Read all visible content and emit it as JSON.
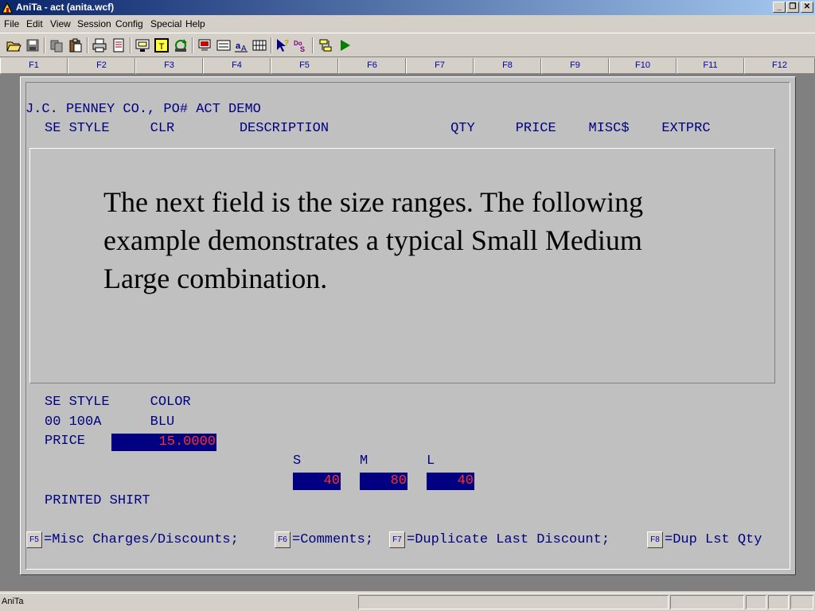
{
  "window": {
    "title": "AniTa -  act (anita.wcf)"
  },
  "menu": [
    "File",
    "Edit",
    "View",
    "Session",
    "Config",
    "Special",
    "Help"
  ],
  "fkeys": [
    "F1",
    "F2",
    "F3",
    "F4",
    "F5",
    "F6",
    "F7",
    "F8",
    "F9",
    "F10",
    "F11",
    "F12"
  ],
  "screen": {
    "header_line1": "J.C. PENNEY CO., PO# ACT DEMO",
    "header_line2": "SE STYLE     CLR        DESCRIPTION               QTY     PRICE    MISC$    EXTPRC",
    "slide_text": "The next field is the size ranges. The following example demonstrates a typical Small Medium Large combination.",
    "labels_row": "SE STYLE     COLOR",
    "values_row": "00 100A      BLU",
    "price_label": "PRICE",
    "price_value": "15.0000",
    "sizes": [
      {
        "label": "S",
        "qty": "40"
      },
      {
        "label": "M",
        "qty": "80"
      },
      {
        "label": "L",
        "qty": "40"
      }
    ],
    "description": "PRINTED SHIRT",
    "footer": {
      "f5_key": "F5",
      "f5_text": "=Misc Charges/Discounts;",
      "f6_key": "F6",
      "f6_text": "=Comments;",
      "f7_key": "F7",
      "f7_text": "=Duplicate Last Discount;",
      "f8_key": "F8",
      "f8_text": "=Dup Lst Qty"
    }
  },
  "status": {
    "text": "AniTa"
  },
  "colors": {
    "titlebar_start": "#0a246a",
    "terminal_text": "#000080",
    "field_bg": "#000080",
    "field_text": "#ff3030"
  },
  "toolbar_icons": [
    "open-icon",
    "save-icon",
    "copy-icon",
    "paste-icon",
    "print-icon",
    "print-preview-icon",
    "screen-icon",
    "capture-icon",
    "refresh-icon",
    "monitor-icon",
    "keyboard-map-icon",
    "font-icon",
    "grid-icon",
    "pointer-help-icon",
    "dos-icon",
    "transfer-icon",
    "run-icon"
  ]
}
